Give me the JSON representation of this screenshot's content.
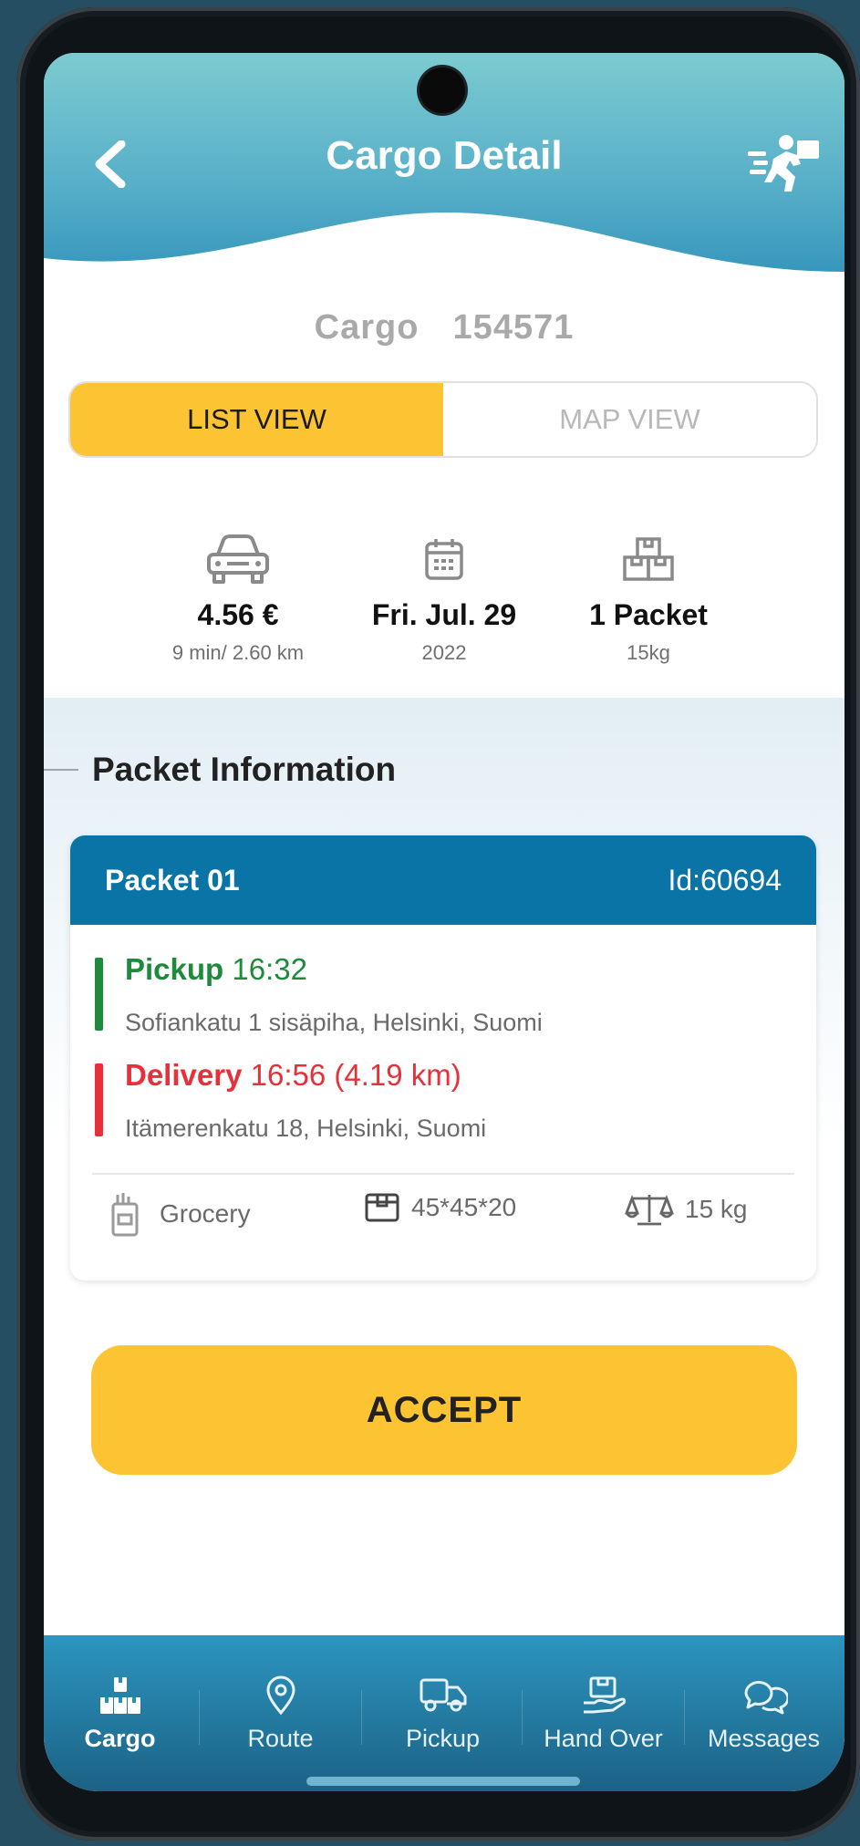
{
  "header": {
    "title": "Cargo Detail"
  },
  "cargo": {
    "label": "Cargo",
    "number": "154571"
  },
  "view_toggle": {
    "list_label": "LIST VIEW",
    "map_label": "MAP VIEW",
    "selected": "LIST VIEW"
  },
  "stats": {
    "price": {
      "main": "4.56 €",
      "sub": "9 min/ 2.60 km"
    },
    "date": {
      "main": "Fri. Jul. 29",
      "sub": "2022"
    },
    "packets": {
      "main": "1 Packet",
      "sub": "15kg"
    }
  },
  "section": {
    "title": "Packet Information"
  },
  "packet": {
    "name": "Packet 01",
    "id": "Id:60694",
    "pickup": {
      "label": "Pickup",
      "time": "16:32",
      "address": "Sofiankatu 1 sisäpiha, Helsinki, Suomi"
    },
    "delivery": {
      "label": "Delivery",
      "time": "16:56 (4.19 km)",
      "address": "Itämerenkatu 18, Helsinki, Suomi"
    },
    "category": "Grocery",
    "dimensions": "45*45*20",
    "weight": "15 kg"
  },
  "accept_label": "ACCEPT",
  "nav": {
    "items": [
      {
        "label": "Cargo",
        "icon": "boxes-icon",
        "active": true
      },
      {
        "label": "Route",
        "icon": "map-pin-icon",
        "active": false
      },
      {
        "label": "Pickup",
        "icon": "truck-icon",
        "active": false
      },
      {
        "label": "Hand Over",
        "icon": "hand-package-icon",
        "active": false
      },
      {
        "label": "Messages",
        "icon": "chat-bubbles-icon",
        "active": false
      }
    ]
  },
  "colors": {
    "accent_yellow": "#fcc333",
    "header_blue": "#0a74a6",
    "pickup_green": "#1e8a3c",
    "delivery_red": "#e8303a"
  }
}
